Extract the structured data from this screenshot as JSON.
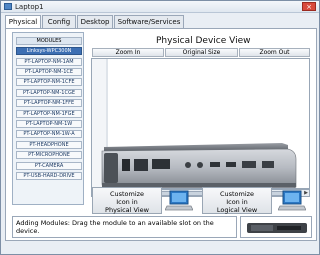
{
  "window": {
    "title": "Laptop1",
    "close_label": "×"
  },
  "tabs": [
    {
      "label": "Physical",
      "active": true
    },
    {
      "label": "Config",
      "active": false
    },
    {
      "label": "Desktop",
      "active": false
    },
    {
      "label": "Software/Services",
      "active": false
    }
  ],
  "modules": {
    "items": [
      "MODULES",
      "Linksys-WPC300N",
      "PT-LAPTOP-NM-1AM",
      "PT-LAPTOP-NM-1CE",
      "PT-LAPTOP-NM-1CFE",
      "PT-LAPTOP-NM-1CGE",
      "PT-LAPTOP-NM-1FFE",
      "PT-LAPTOP-NM-1FGE",
      "PT-LAPTOP-NM-1W",
      "PT-LAPTOP-NM-1W-A",
      "PT-HEADPHONE",
      "PT-MICROPHONE",
      "PT-CAMERA",
      "PT-USB-HARD-DRIVE"
    ]
  },
  "device_view": {
    "title": "Physical Device View",
    "zoom_in": "Zoom In",
    "original_size": "Original Size",
    "zoom_out": "Zoom Out"
  },
  "customize": {
    "physical": {
      "line1": "Customize",
      "line2": "Icon in",
      "line3": "Physical View"
    },
    "logical": {
      "line1": "Customize",
      "line2": "Icon in",
      "line3": "Logical View"
    }
  },
  "status": {
    "text": "Adding Modules: Drag the module to an available slot on the device."
  },
  "colors": {
    "selected_module": "#3d6fb3",
    "module_text": "#1e3c66"
  }
}
